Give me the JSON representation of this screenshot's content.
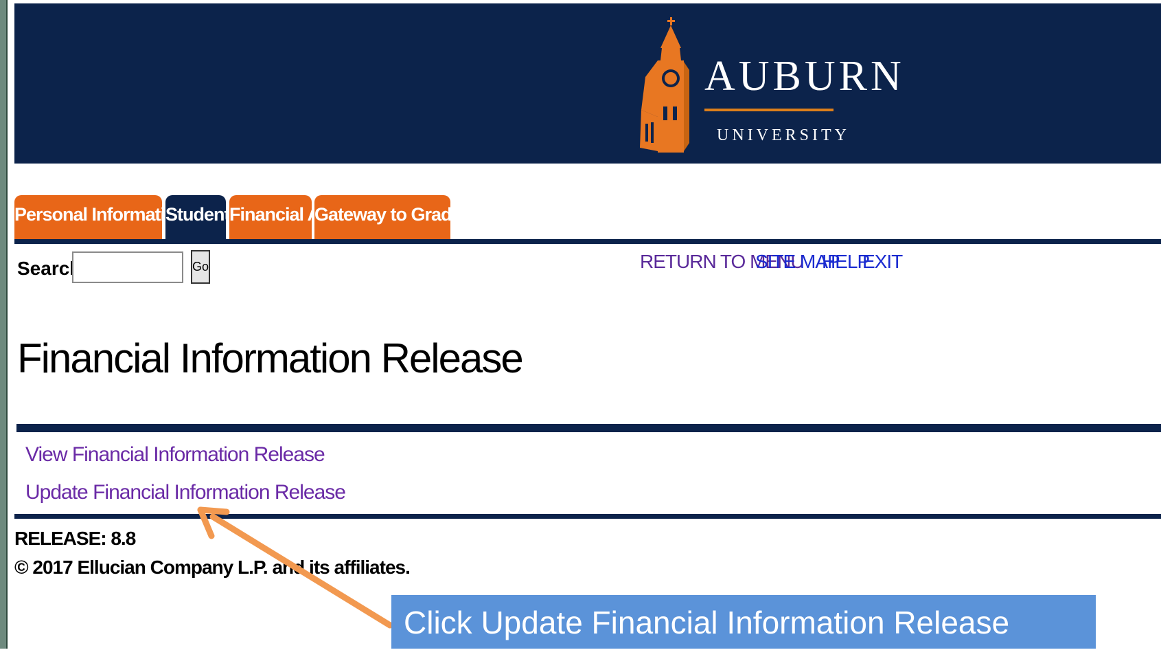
{
  "header": {
    "logo_word": "AUBURN",
    "logo_sub": "UNIVERSITY",
    "bg_color": "#0c234b",
    "accent_color": "#dd7f1b"
  },
  "tabs": [
    {
      "label": "Personal Information",
      "active": false
    },
    {
      "label": "Student",
      "active": true
    },
    {
      "label": "Financial Aid",
      "active": false
    },
    {
      "label": "Gateway to Grades",
      "active": false
    }
  ],
  "search": {
    "label": "Search",
    "value": "",
    "go_label": "Go"
  },
  "toplinks": [
    {
      "label": "RETURN TO MENU",
      "color": "#5a2a9a"
    },
    {
      "label": "SITE MAP",
      "color": "#1a2bd0"
    },
    {
      "label": "HELP",
      "color": "#1a2bd0"
    },
    {
      "label": "EXIT",
      "color": "#1a2bd0"
    }
  ],
  "page_title": "Financial Information Release",
  "menu_links": [
    {
      "label": "View Financial Information Release"
    },
    {
      "label": "Update Financial Information Release"
    }
  ],
  "footer": {
    "release": "RELEASE: 8.8",
    "copyright": "© 2017 Ellucian Company L.P. and its affiliates."
  },
  "callout": {
    "text": "Click Update Financial Information Release",
    "bg_color": "#5b93d9",
    "arrow_color": "#f29950"
  }
}
